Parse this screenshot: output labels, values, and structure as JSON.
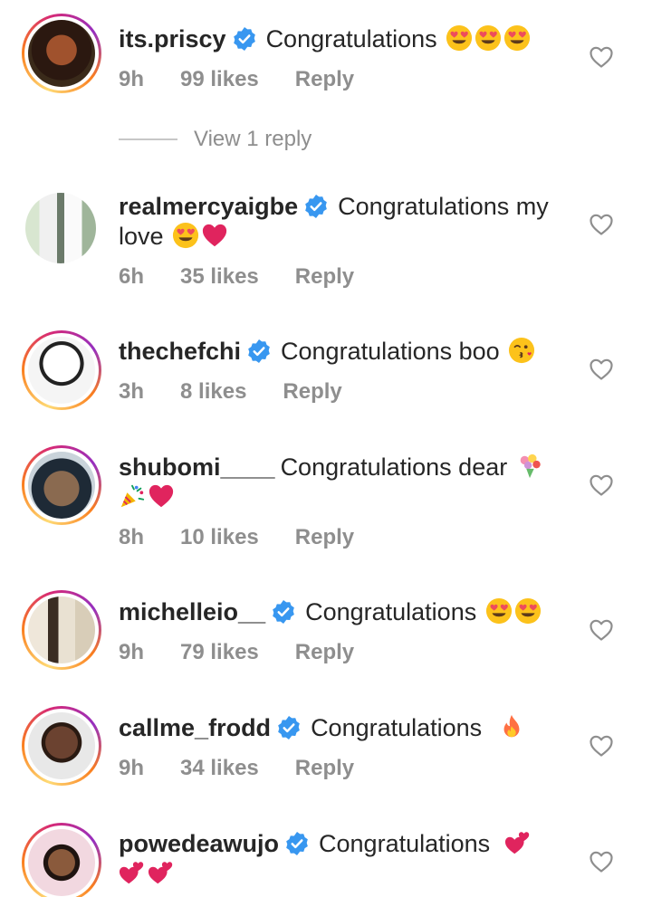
{
  "comments": [
    {
      "username": "its.priscy",
      "verified": true,
      "text": "Congratulations",
      "emojis": [
        "heart-eyes",
        "heart-eyes",
        "heart-eyes"
      ],
      "time": "9h",
      "likes": "99 likes",
      "reply": "Reply",
      "view_replies": "View 1 reply"
    },
    {
      "username": "realmercyaigbe",
      "verified": true,
      "text": "Congratulations my love",
      "emojis": [
        "heart-eyes",
        "red-heart"
      ],
      "time": "6h",
      "likes": "35 likes",
      "reply": "Reply"
    },
    {
      "username": "thechefchi",
      "verified": true,
      "text": "Congratulations boo",
      "emojis": [
        "kiss-face"
      ],
      "time": "3h",
      "likes": "8 likes",
      "reply": "Reply"
    },
    {
      "username": "shubomi____",
      "verified": false,
      "text": "Congratulations dear",
      "emojis": [
        "bouquet",
        "party-popper",
        "red-heart"
      ],
      "time": "8h",
      "likes": "10 likes",
      "reply": "Reply"
    },
    {
      "username": "michelleio__",
      "verified": true,
      "text": "Congratulations",
      "emojis": [
        "heart-eyes",
        "heart-eyes"
      ],
      "time": "9h",
      "likes": "79 likes",
      "reply": "Reply"
    },
    {
      "username": "callme_frodd",
      "verified": true,
      "text": "Congratulations",
      "emojis": [
        "fire"
      ],
      "time": "9h",
      "likes": "34 likes",
      "reply": "Reply"
    },
    {
      "username": "powedeawujo",
      "verified": true,
      "text": "Congratulations",
      "emojis": [
        "two-hearts",
        "two-hearts",
        "two-hearts"
      ],
      "time": "",
      "likes": "",
      "reply": ""
    }
  ],
  "colors": {
    "verified": "#3897f0",
    "meta": "#8e8e8e",
    "text": "#262626",
    "heart_red": "#e0245e"
  }
}
